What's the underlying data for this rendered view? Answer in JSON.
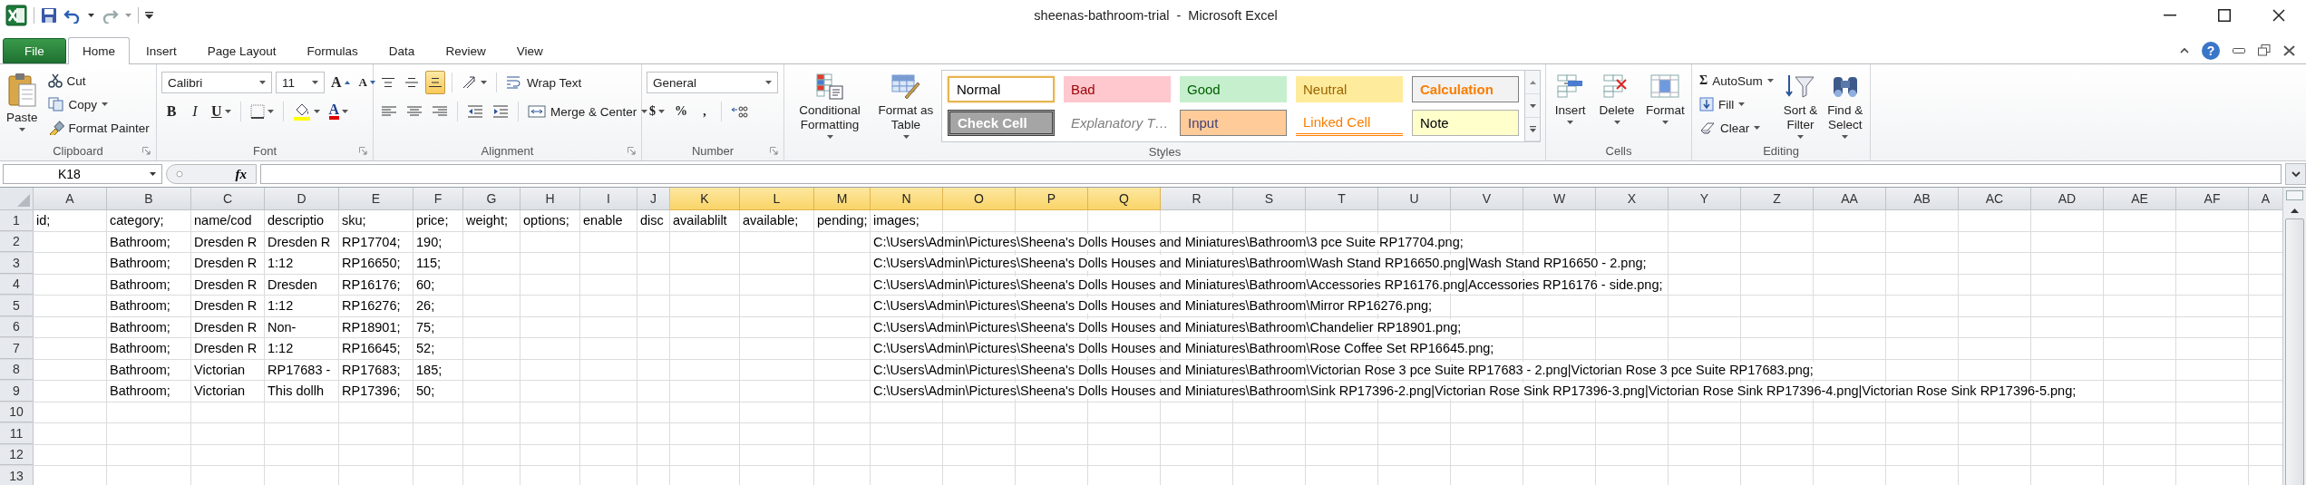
{
  "window": {
    "title": "sheenas-bathroom-trial  -  Microsoft Excel",
    "help_symbol": "?"
  },
  "tabs": [
    {
      "label": "File",
      "kind": "file",
      "selected": false
    },
    {
      "label": "Home",
      "kind": "tab",
      "selected": true
    },
    {
      "label": "Insert",
      "kind": "tab",
      "selected": false
    },
    {
      "label": "Page Layout",
      "kind": "tab",
      "selected": false
    },
    {
      "label": "Formulas",
      "kind": "tab",
      "selected": false
    },
    {
      "label": "Data",
      "kind": "tab",
      "selected": false
    },
    {
      "label": "Review",
      "kind": "tab",
      "selected": false
    },
    {
      "label": "View",
      "kind": "tab",
      "selected": false
    }
  ],
  "clipboard": {
    "paste": "Paste",
    "cut": "Cut",
    "copy": "Copy",
    "format_painter": "Format Painter",
    "label": "Clipboard"
  },
  "font": {
    "name": "Calibri",
    "size": "11",
    "grow": "A",
    "shrink": "A",
    "bold": "B",
    "italic": "I",
    "underline": "U",
    "font_color": "A",
    "label": "Font"
  },
  "alignment": {
    "align_buttons": [
      {
        "kind": "top",
        "selected": false
      },
      {
        "kind": "middle",
        "selected": false
      },
      {
        "kind": "bottom",
        "selected": true
      }
    ],
    "wrap_text": "Wrap Text",
    "merge_center": "Merge & Center",
    "label": "Alignment"
  },
  "number": {
    "format": "General",
    "currency": "$",
    "percent": "%",
    "comma": ",",
    "label": "Number"
  },
  "styles": {
    "conditional_formatting": "Conditional Formatting",
    "format_as_table": "Format as Table",
    "cell_styles": [
      {
        "label": "Normal",
        "kind": "normal",
        "selected": true
      },
      {
        "label": "Bad",
        "kind": "bad",
        "selected": false
      },
      {
        "label": "Good",
        "kind": "good",
        "selected": false
      },
      {
        "label": "Neutral",
        "kind": "neutral",
        "selected": false
      },
      {
        "label": "Calculation",
        "kind": "calculation",
        "selected": false
      },
      {
        "label": "Check Cell",
        "kind": "check",
        "selected": false
      },
      {
        "label": "Explanatory T…",
        "kind": "explanatory",
        "selected": false
      },
      {
        "label": "Input",
        "kind": "input",
        "selected": false
      },
      {
        "label": "Linked Cell",
        "kind": "linked",
        "selected": false
      },
      {
        "label": "Note",
        "kind": "note",
        "selected": false
      }
    ],
    "label": "Styles"
  },
  "cells": {
    "insert": "Insert",
    "delete": "Delete",
    "format": "Format",
    "label": "Cells"
  },
  "editing": {
    "autosum_symbol": "Σ",
    "autosum": "AutoSum",
    "fill": "Fill",
    "clear": "Clear",
    "sort_filter": "Sort & Filter",
    "find_select": "Find & Select",
    "label": "Editing"
  },
  "formula_bar": {
    "name_box": "K18",
    "function_label": "fx"
  },
  "sheet": {
    "columns": [
      {
        "label": "A",
        "selected": false
      },
      {
        "label": "B",
        "selected": false
      },
      {
        "label": "C",
        "selected": false
      },
      {
        "label": "D",
        "selected": false
      },
      {
        "label": "E",
        "selected": false
      },
      {
        "label": "F",
        "selected": false
      },
      {
        "label": "G",
        "selected": false
      },
      {
        "label": "H",
        "selected": false
      },
      {
        "label": "I",
        "selected": false
      },
      {
        "label": "J",
        "selected": false
      },
      {
        "label": "K",
        "selected": true
      },
      {
        "label": "L",
        "selected": true
      },
      {
        "label": "M",
        "selected": true
      },
      {
        "label": "N",
        "selected": true
      },
      {
        "label": "O",
        "selected": true
      },
      {
        "label": "P",
        "selected": true
      },
      {
        "label": "Q",
        "selected": true
      },
      {
        "label": "R",
        "selected": false
      },
      {
        "label": "S",
        "selected": false
      },
      {
        "label": "T",
        "selected": false
      },
      {
        "label": "U",
        "selected": false
      },
      {
        "label": "V",
        "selected": false
      },
      {
        "label": "W",
        "selected": false
      },
      {
        "label": "X",
        "selected": false
      },
      {
        "label": "Y",
        "selected": false
      },
      {
        "label": "Z",
        "selected": false
      },
      {
        "label": "AA",
        "selected": false
      },
      {
        "label": "AB",
        "selected": false
      },
      {
        "label": "AC",
        "selected": false
      },
      {
        "label": "AD",
        "selected": false
      },
      {
        "label": "AE",
        "selected": false
      },
      {
        "label": "AF",
        "selected": false
      },
      {
        "label": "A",
        "selected": false
      }
    ],
    "rows": [
      {
        "header": "1",
        "cells": {
          "A": "id;",
          "B": "category;",
          "C": "name/cod",
          "D": "descriptio",
          "E": "sku;",
          "F": "price;",
          "G": "weight;",
          "H": "options;",
          "I": "enable",
          "J": "disc",
          "K": "availablilt",
          "L": "available;",
          "M": "pending;",
          "N": "images;"
        }
      },
      {
        "header": "2",
        "cells": {
          "B": "Bathroom;",
          "C": "Dresden R",
          "D": "Dresden R",
          "E": "RP17704;",
          "F": "190;",
          "N": "C:\\Users\\Admin\\Pictures\\Sheena's Dolls Houses and Miniatures\\Bathroom\\3 pce Suite RP17704.png;"
        }
      },
      {
        "header": "3",
        "cells": {
          "B": "Bathroom;",
          "C": "Dresden R",
          "D": "1:12",
          "E": "RP16650;",
          "F": "115;",
          "N": "C:\\Users\\Admin\\Pictures\\Sheena's Dolls Houses and Miniatures\\Bathroom\\Wash Stand RP16650.png|Wash Stand RP16650 - 2.png;"
        }
      },
      {
        "header": "4",
        "cells": {
          "B": "Bathroom;",
          "C": "Dresden R",
          "D": "Dresden",
          "E": "RP16176;",
          "F": "60;",
          "N": "C:\\Users\\Admin\\Pictures\\Sheena's Dolls Houses and Miniatures\\Bathroom\\Accessories RP16176.png|Accessories RP16176 - side.png;"
        }
      },
      {
        "header": "5",
        "cells": {
          "B": "Bathroom;",
          "C": "Dresden R",
          "D": "1:12",
          "E": "RP16276;",
          "F": "26;",
          "N": "C:\\Users\\Admin\\Pictures\\Sheena's Dolls Houses and Miniatures\\Bathroom\\Mirror RP16276.png;"
        }
      },
      {
        "header": "6",
        "cells": {
          "B": "Bathroom;",
          "C": "Dresden R",
          "D": "Non-",
          "E": "RP18901;",
          "F": "75;",
          "N": "C:\\Users\\Admin\\Pictures\\Sheena's Dolls Houses and Miniatures\\Bathroom\\Chandelier RP18901.png;"
        }
      },
      {
        "header": "7",
        "cells": {
          "B": "Bathroom;",
          "C": "Dresden R",
          "D": "1:12",
          "E": "RP16645;",
          "F": "52;",
          "N": "C:\\Users\\Admin\\Pictures\\Sheena's Dolls Houses and Miniatures\\Bathroom\\Rose Coffee Set RP16645.png;"
        }
      },
      {
        "header": "8",
        "cells": {
          "B": "Bathroom;",
          "C": "Victorian",
          "D": "RP17683 -",
          "E": "RP17683;",
          "F": "185;",
          "N": "C:\\Users\\Admin\\Pictures\\Sheena's Dolls Houses and Miniatures\\Bathroom\\Victorian Rose 3 pce Suite RP17683 - 2.png|Victorian Rose 3 pce Suite RP17683.png;"
        }
      },
      {
        "header": "9",
        "cells": {
          "B": "Bathroom;",
          "C": "Victorian",
          "D": "This dollh",
          "E": "RP17396;",
          "F": "50;",
          "N": "C:\\Users\\Admin\\Pictures\\Sheena's Dolls Houses and Miniatures\\Bathroom\\Sink RP17396-2.png|Victorian Rose Sink RP17396-3.png|Victorian Rose Sink RP17396-4.png|Victorian Rose Sink RP17396-5.png;"
        }
      },
      {
        "header": "10",
        "cells": {}
      },
      {
        "header": "11",
        "cells": {}
      },
      {
        "header": "12",
        "cells": {}
      },
      {
        "header": "13",
        "cells": {}
      }
    ]
  }
}
